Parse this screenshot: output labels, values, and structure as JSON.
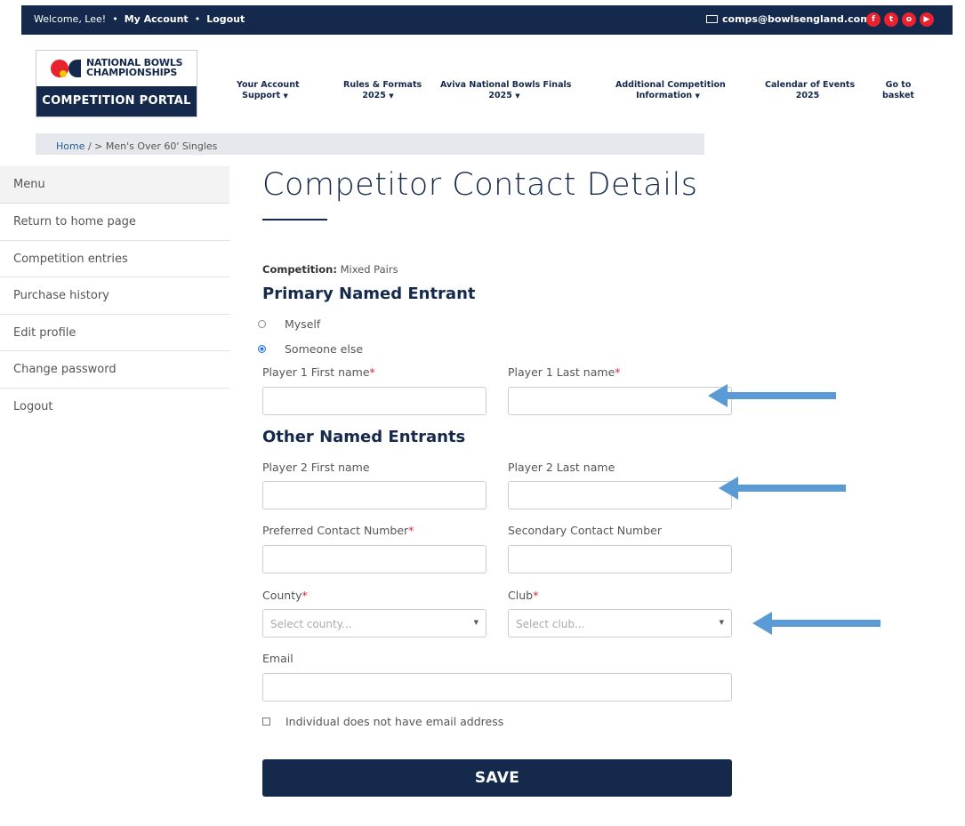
{
  "topbar": {
    "welcome": "Welcome, Lee!",
    "sep1": "•",
    "my_account": "My Account",
    "sep2": "•",
    "logout": "Logout",
    "email": "comps@bowlsengland.com",
    "social": [
      "f",
      "t",
      "o",
      "▶"
    ]
  },
  "logo": {
    "line1": "NATIONAL BOWLS",
    "line2": "CHAMPIONSHIPS",
    "portal": "COMPETITION PORTAL"
  },
  "nav": [
    {
      "line1": "Your Account",
      "line2": "Support",
      "caret": "▼"
    },
    {
      "line1": "Rules & Formats",
      "line2": "2025",
      "caret": "▼"
    },
    {
      "line1": "Aviva National Bowls Finals",
      "line2": "2025",
      "caret": "▼"
    },
    {
      "line1": "Additional Competition",
      "line2": "Information",
      "caret": "▼"
    },
    {
      "line1": "Calendar of Events",
      "line2": "2025",
      "caret": ""
    },
    {
      "line1": "Go to",
      "line2": "basket",
      "caret": ""
    }
  ],
  "breadcrumb": {
    "home": "Home",
    "rest": " / > Men's Over 60' Singles"
  },
  "sidebar": {
    "heading": "Menu",
    "items": [
      "Return to home page",
      "Competition entries",
      "Purchase history",
      "Edit profile",
      "Change password",
      "Logout"
    ]
  },
  "main": {
    "title": "Competitor Contact Details",
    "competition_label": "Competition:",
    "competition_value": "Mixed Pairs",
    "primary_heading": "Primary Named Entrant",
    "radio_myself": "Myself",
    "radio_someone": "Someone else",
    "selected_radio": "Someone else",
    "p1_first": "Player 1 First name",
    "p1_last": "Player 1 Last name",
    "other_heading": "Other Named Entrants",
    "p2_first": "Player 2 First name",
    "p2_last": "Player 2 Last name",
    "pref_contact": "Preferred Contact Number",
    "sec_contact": "Secondary Contact Number",
    "county": "County",
    "county_placeholder": "Select county...",
    "club": "Club",
    "club_placeholder": "Select club...",
    "email": "Email",
    "no_email": "Individual does not have email address",
    "save": "SAVE",
    "required_mark": "*"
  },
  "colors": {
    "navy": "#14294b",
    "red": "#e8222e",
    "annotation_blue": "#5b9bd5"
  }
}
